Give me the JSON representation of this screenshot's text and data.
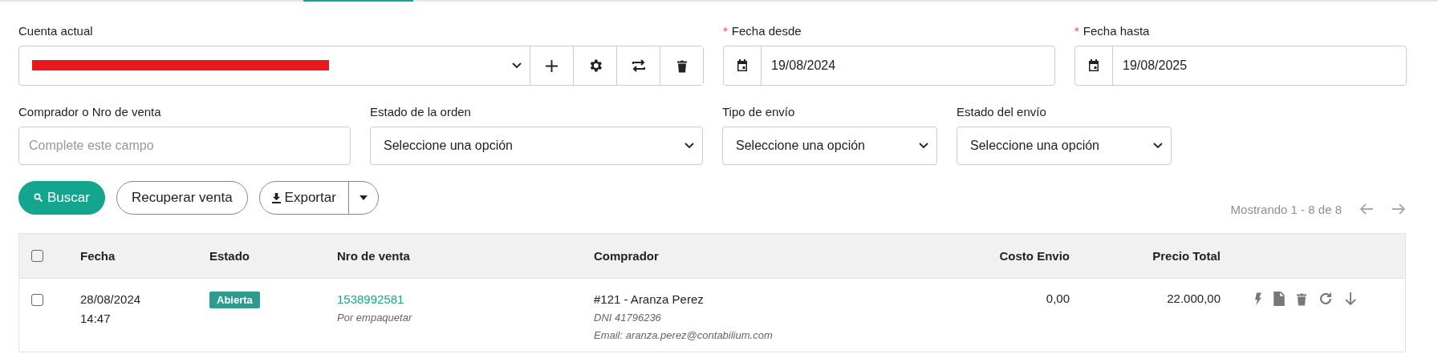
{
  "account": {
    "label": "Cuenta actual",
    "redacted": true
  },
  "date_from": {
    "label": "Fecha desde",
    "required_mark": "*",
    "value": "19/08/2024"
  },
  "date_to": {
    "label": "Fecha hasta",
    "required_mark": "*",
    "value": "19/08/2025"
  },
  "buyer": {
    "label": "Comprador o Nro de venta",
    "placeholder": "Complete este campo"
  },
  "selects": [
    {
      "label": "Estado de la orden",
      "value": "Seleccione una opción",
      "kind": "wide"
    },
    {
      "label": "Tipo de envío",
      "value": "Seleccione una opción",
      "kind": "narrow"
    },
    {
      "label": "Estado del envío",
      "value": "Seleccione una opción",
      "kind": "narrow"
    }
  ],
  "buttons": {
    "search": "Buscar",
    "recover": "Recuperar venta",
    "export": "Exportar"
  },
  "pagination": "Mostrando 1 - 8 de 8",
  "table": {
    "columns": [
      "Fecha",
      "Estado",
      "Nro de venta",
      "Comprador",
      "Costo Envio",
      "Precio Total"
    ],
    "all_checked": false,
    "rows": [
      {
        "checked": false,
        "date": "28/08/2024",
        "time": "14:47",
        "status": "Abierta",
        "sale": "1538992581",
        "sale_note": "Por empaquetar",
        "buyer": "#121 - Aranza Perez",
        "dni": "DNI 41796236",
        "email": "Email: aranza.perez@contabilium.com",
        "shipping": "0,00",
        "total": "22.000,00"
      }
    ]
  }
}
